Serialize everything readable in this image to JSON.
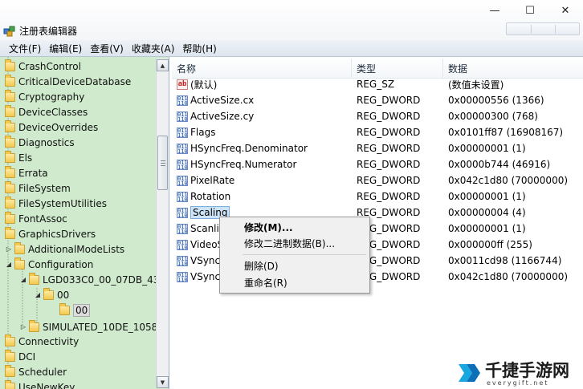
{
  "window": {
    "title": "注册表编辑器",
    "controls": {
      "minimize": "—",
      "maximize": "☐",
      "close": "✕"
    }
  },
  "menu": [
    "文件(F)",
    "编辑(E)",
    "查看(V)",
    "收藏夹(A)",
    "帮助(H)"
  ],
  "tree": {
    "items": [
      {
        "label": "CrashControl"
      },
      {
        "label": "CriticalDeviceDatabase"
      },
      {
        "label": "Cryptography"
      },
      {
        "label": "DeviceClasses"
      },
      {
        "label": "DeviceOverrides"
      },
      {
        "label": "Diagnostics"
      },
      {
        "label": "Els"
      },
      {
        "label": "Errata"
      },
      {
        "label": "FileSystem"
      },
      {
        "label": "FileSystemUtilities"
      },
      {
        "label": "FontAssoc"
      },
      {
        "label": "GraphicsDrivers"
      },
      {
        "label": "AdditionalModeLists",
        "expander": "▷"
      },
      {
        "label": "Configuration",
        "expander": "◢"
      },
      {
        "label": "LGD033C0_00_07DB_43^",
        "expander": "◢"
      },
      {
        "label": "00",
        "expander": "◢"
      },
      {
        "label": "00"
      },
      {
        "label": "SIMULATED_10DE_1058_",
        "expander": "▷"
      },
      {
        "label": "Connectivity"
      },
      {
        "label": "DCI"
      },
      {
        "label": "Scheduler"
      },
      {
        "label": "UseNewKey"
      }
    ]
  },
  "values": {
    "headers": {
      "name": "名称",
      "type": "类型",
      "data": "数据"
    },
    "rows": [
      {
        "name": "(默认)",
        "type": "REG_SZ",
        "data": "(数值未设置)",
        "icon": "string-value-icon"
      },
      {
        "name": "ActiveSize.cx",
        "type": "REG_DWORD",
        "data": "0x00000556 (1366)",
        "icon": "binary-value-icon"
      },
      {
        "name": "ActiveSize.cy",
        "type": "REG_DWORD",
        "data": "0x00000300 (768)",
        "icon": "binary-value-icon"
      },
      {
        "name": "Flags",
        "type": "REG_DWORD",
        "data": "0x0101ff87 (16908167)",
        "icon": "binary-value-icon"
      },
      {
        "name": "HSyncFreq.Denominator",
        "type": "REG_DWORD",
        "data": "0x00000001 (1)",
        "icon": "binary-value-icon"
      },
      {
        "name": "HSyncFreq.Numerator",
        "type": "REG_DWORD",
        "data": "0x0000b744 (46916)",
        "icon": "binary-value-icon"
      },
      {
        "name": "PixelRate",
        "type": "REG_DWORD",
        "data": "0x042c1d80 (70000000)",
        "icon": "binary-value-icon"
      },
      {
        "name": "Rotation",
        "type": "REG_DWORD",
        "data": "0x00000001 (1)",
        "icon": "binary-value-icon"
      },
      {
        "name": "Scaling",
        "type": "REG_DWORD",
        "data": "0x00000004 (4)",
        "icon": "binary-value-icon"
      },
      {
        "name": "Scanlin",
        "type": "REG_DWORD",
        "data": "0x00000001 (1)",
        "icon": "binary-value-icon"
      },
      {
        "name": "VideoS",
        "type": "REG_DWORD",
        "data": "0x000000ff (255)",
        "icon": "binary-value-icon"
      },
      {
        "name": "VSync",
        "type": "REG_DWORD",
        "data": "0x0011cd98 (1166744)",
        "icon": "binary-value-icon"
      },
      {
        "name": "VSync",
        "type": "REG_DWORD",
        "data": "0x042c1d80 (70000000)",
        "icon": "binary-value-icon"
      }
    ]
  },
  "context_menu": {
    "modify": "修改(M)...",
    "modify_binary": "修改二进制数据(B)...",
    "delete": "删除(D)",
    "rename": "重命名(R)"
  },
  "watermark": {
    "title": "千捷手游网",
    "subtitle": "everygift.net"
  },
  "icons": [
    "registry-editor-icon",
    "folder-icon",
    "string-value-icon",
    "binary-value-icon",
    "scroll-up-icon",
    "scroll-down-icon"
  ]
}
